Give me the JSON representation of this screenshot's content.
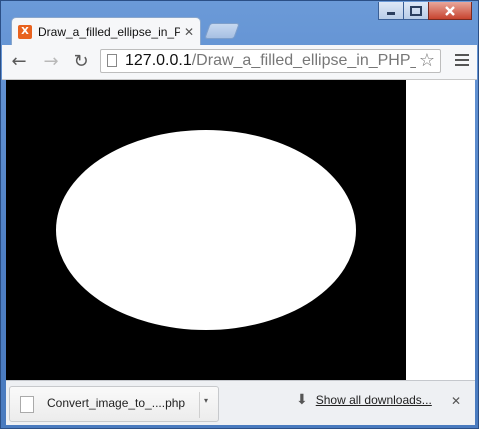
{
  "window": {
    "controls": {
      "minimize": "▁",
      "maximize": "☐",
      "close": "✕"
    }
  },
  "tab": {
    "title": "Draw_a_filled_ellipse_in_PHP",
    "favicon_letter": "X",
    "favicon_color": "#e8621f",
    "close": "✕"
  },
  "toolbar": {
    "back": "←",
    "forward": "→",
    "reload": "↻",
    "url_host": "127.0.0.1",
    "url_path": "/Draw_a_filled_ellipse_in_PHP_Ex",
    "star": "☆"
  },
  "content": {
    "canvas_background": "#000000",
    "ellipse_fill": "#ffffff"
  },
  "download_shelf": {
    "file_name": "Convert_image_to_....php",
    "dropdown": "▾",
    "show_all_icon": "⬇",
    "show_all_label": "Show all downloads...",
    "close": "✕"
  }
}
